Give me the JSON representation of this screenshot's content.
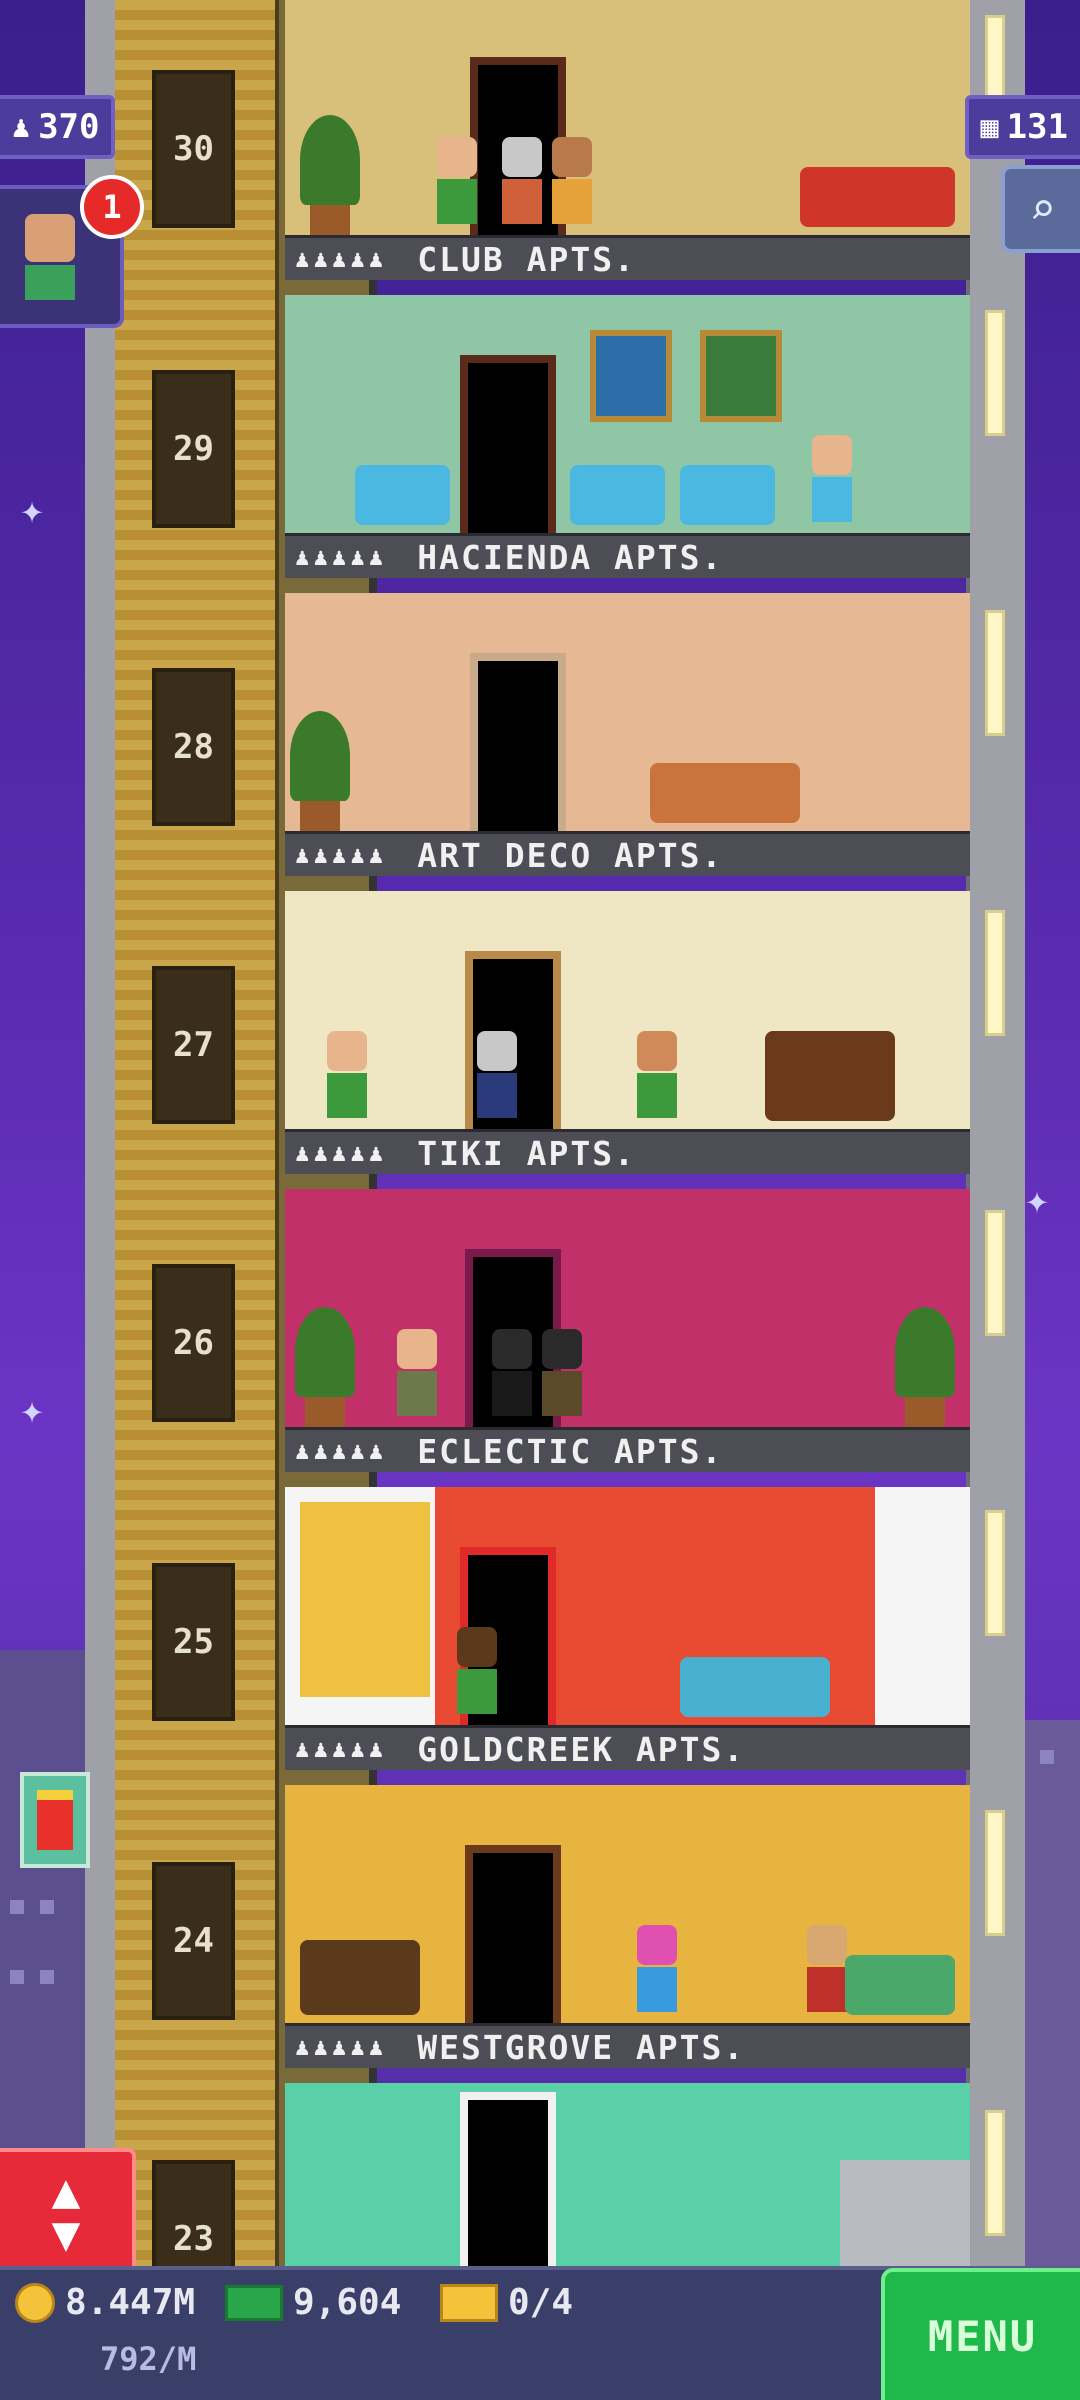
{
  "hud": {
    "population": "370",
    "floors_count": "131",
    "notification_count": "1"
  },
  "floors": [
    {
      "number": "30",
      "label": "CLUB APTS."
    },
    {
      "number": "29",
      "label": "HACIENDA APTS."
    },
    {
      "number": "28",
      "label": "ART DECO APTS."
    },
    {
      "number": "27",
      "label": "TIKI APTS."
    },
    {
      "number": "26",
      "label": "ECLECTIC APTS."
    },
    {
      "number": "25",
      "label": "GOLDCREEK APTS."
    },
    {
      "number": "24",
      "label": "WESTGROVE APTS."
    },
    {
      "number": "23",
      "label": ""
    }
  ],
  "bottom_bar": {
    "coins": "8.447M",
    "coins_rate": "792/M",
    "bux": "9,604",
    "tickets": "0/4",
    "menu_label": "MENU"
  },
  "icons": {
    "population": "person-icon",
    "floors": "building-icon",
    "zoom": "magnifier-icon",
    "elevator": "up-down-arrow-icon",
    "coin": "coin-icon",
    "bux": "cash-icon",
    "ticket": "ticket-icon"
  },
  "colors": {
    "sky": "#5a2bb0",
    "menu_green": "#1fb84a",
    "elevator_red": "#e62a3a",
    "badge_red": "#e62a2a"
  }
}
